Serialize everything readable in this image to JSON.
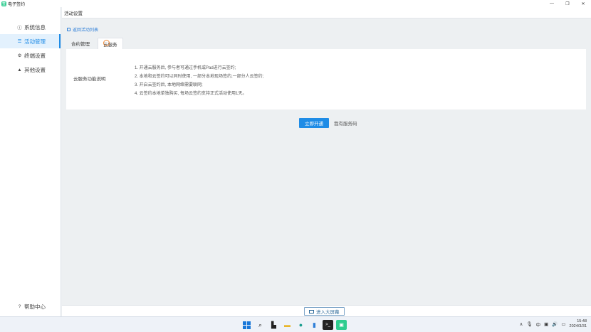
{
  "window": {
    "title": "电子签约",
    "logo_glyph": "签",
    "controls": [
      "—",
      "❐",
      "✕"
    ]
  },
  "sidebar": {
    "items": [
      {
        "label": "系统信息",
        "icon": "info-circle-icon",
        "glyph": "ⓘ",
        "active": false
      },
      {
        "label": "活动管理",
        "icon": "list-icon",
        "glyph": "☰",
        "active": true
      },
      {
        "label": "终端设置",
        "icon": "gear-icon",
        "glyph": "⚙",
        "active": false
      },
      {
        "label": "其他设置",
        "icon": "warning-icon",
        "glyph": "▲",
        "active": false
      }
    ],
    "help": {
      "label": "帮助中心",
      "icon": "help-circle-icon",
      "glyph": "?"
    }
  },
  "header": {
    "title": "活动设置"
  },
  "back_link": {
    "label": "返回活动列表"
  },
  "tabs": [
    {
      "label": "合约管理",
      "active": false
    },
    {
      "label": "云服务",
      "active": true
    }
  ],
  "card": {
    "label": "云服务功能说明",
    "lines": [
      "1. 开通云服务后, 参与者可通过手机或Pad进行云签约;",
      "2. 本地和云签约可以同时使用, 一部分本地现场签约,一部分人云签约;",
      "3. 开启云签约后, 本地网络需要联网;",
      "4. 云签约本地单独购买, 每场云签约支持正式活动使用1天。"
    ]
  },
  "actions": {
    "primary": "立即开通",
    "secondary": "我有服务码"
  },
  "footer": {
    "bigscreen": "进入大屏幕"
  },
  "taskbar": {
    "apps": [
      "windows-start-icon",
      "search-icon",
      "task-view-icon",
      "file-explorer-icon",
      "edge-browser-icon",
      "notepad-icon",
      "terminal-icon",
      "app-icon"
    ],
    "tray": {
      "chevron": "∧",
      "mic": "🎙",
      "ime": "中",
      "network": "▣",
      "volume": "🔊",
      "battery": "▭"
    },
    "time": "15:48",
    "date": "2024/3/31"
  },
  "colors": {
    "accent": "#1f8ce6",
    "sidebar_active_bg": "#e3f1fd",
    "page_bg": "#edf0f2",
    "logo": "#2ecc8f"
  }
}
